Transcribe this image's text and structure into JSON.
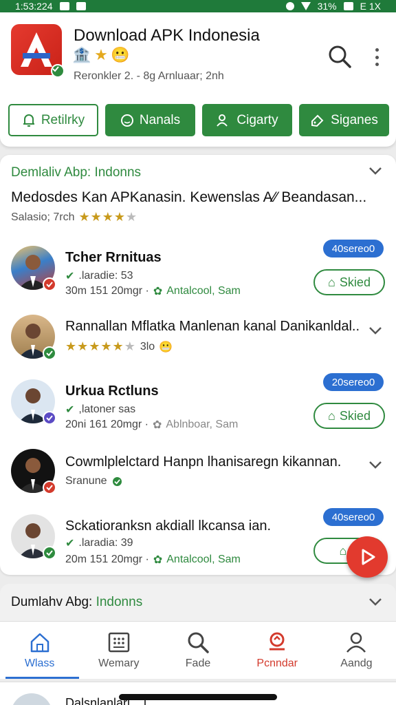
{
  "status_bar": {
    "time": "1:53:224",
    "battery": "31%",
    "network": "E 1X"
  },
  "app": {
    "title": "Download APK Indonesia",
    "subtitle": "Reronkler 2. - 8g Arnluaar; 2nh",
    "badges": [
      "bank-icon",
      "star-icon",
      "emoji-icon"
    ]
  },
  "actions": [
    {
      "label": "Retilrky",
      "style": "outline",
      "icon": "bell-icon"
    },
    {
      "label": "Nanals",
      "style": "fill",
      "icon": "smile-icon"
    },
    {
      "label": "Cigarty",
      "style": "fill",
      "icon": "users-icon"
    },
    {
      "label": "Siganes",
      "style": "fill",
      "icon": "tag-icon"
    }
  ],
  "section": {
    "title": "Demlaliv Abp: Indonns",
    "description": "Medosdes Kan APKanasin. Kewenslas A∕∕ Beandasan...",
    "meta_text": "Salasio; 7rch",
    "rating": 4
  },
  "items": [
    {
      "name": "Tcher Rrnituas",
      "bold": true,
      "line1": ".laradie: 53",
      "line2_time": "30m 151 20mgr ·",
      "line2_source": "Antalcool, Sam",
      "source_green": true,
      "pill": "40sereo0",
      "saved_label": "Skied"
    },
    {
      "name": "Rannallan Mflatka Manlenan kanal Danikanldal..",
      "bold": false,
      "rating": 4,
      "rating_text": "3lo",
      "chevron": true
    },
    {
      "name": "Urkua Rctluns",
      "bold": true,
      "line1": ",latoner sas",
      "line2_time": "20ni 161 20mgr ·",
      "line2_source": "Ablnboar, Sam",
      "source_green": false,
      "pill": "20sereo0",
      "saved_label": "Skied"
    },
    {
      "name": "Cowmlplelctard Hanpn lhanisaregn kikannan.",
      "bold": false,
      "sub": "Sranune",
      "chevron": true
    },
    {
      "name": "Sckatioranksn akdiall lkcansa ian.",
      "bold": false,
      "line1": ".laradia: 39",
      "line2_time": "20m 151 20mgr ·",
      "line2_source": "Antalcool, Sam",
      "source_green": true,
      "pill": "40sereo0",
      "saved_label": "S"
    }
  ],
  "section2": {
    "title_prefix": "Dumlahv Abg:",
    "title_suffix": "Indonns"
  },
  "bottom_nav": [
    {
      "label": "Wlass",
      "icon": "home-icon",
      "state": "active"
    },
    {
      "label": "Wemary",
      "icon": "grid-icon",
      "state": "normal"
    },
    {
      "label": "Fade",
      "icon": "search-icon",
      "state": "normal"
    },
    {
      "label": "Pcnndar",
      "icon": "ticket-icon",
      "state": "red"
    },
    {
      "label": "Aandg",
      "icon": "profile-icon",
      "state": "normal"
    }
  ],
  "peek": {
    "text": "Dalsnlanlarl ...l"
  },
  "colors": {
    "primary_green": "#2f8a3f",
    "accent_blue": "#2c6fd1",
    "accent_red": "#e23a2e",
    "star": "#c89a1c"
  }
}
